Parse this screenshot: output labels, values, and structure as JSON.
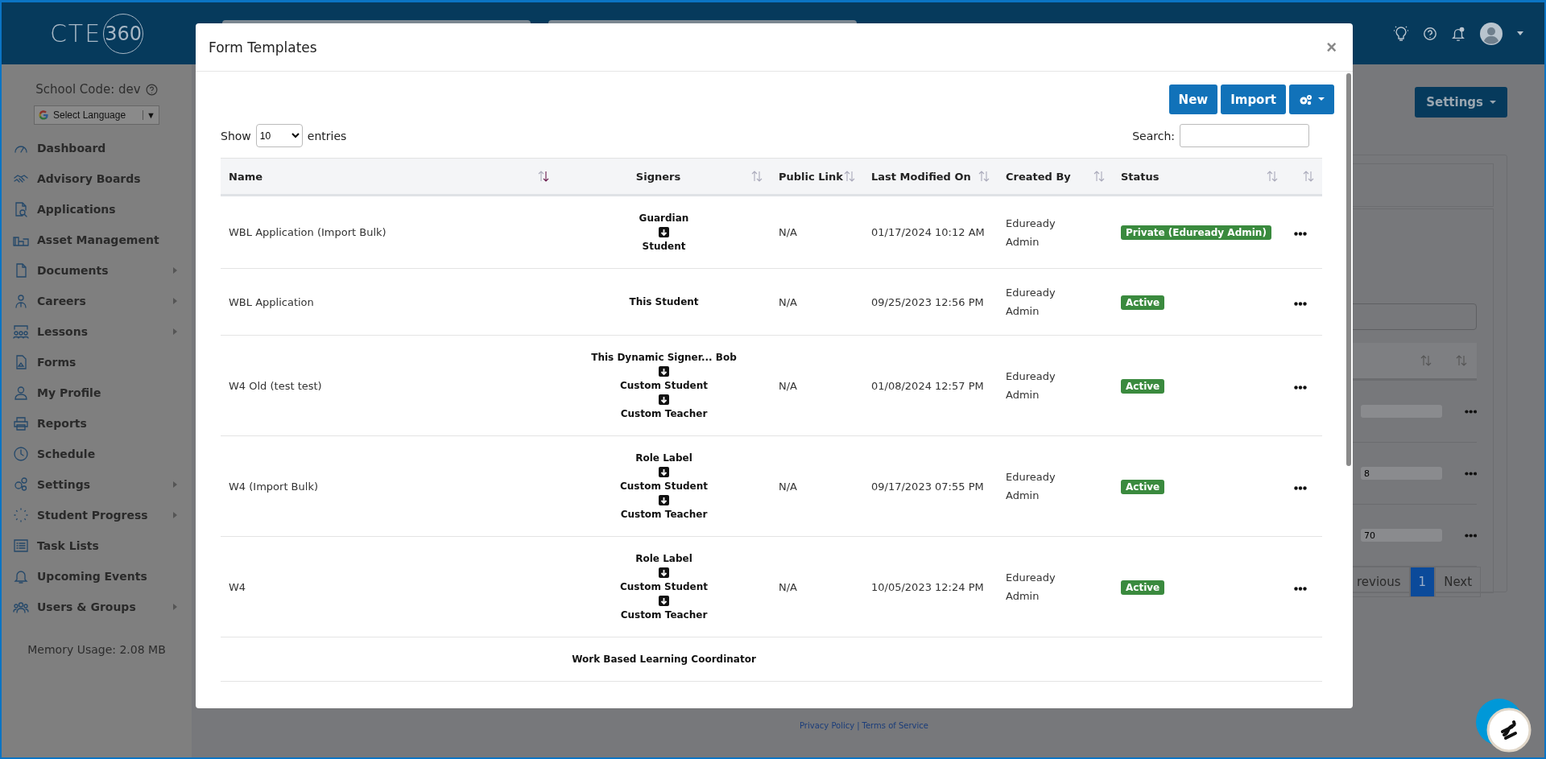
{
  "app": {
    "logo": "CTE",
    "logo_badge": "360"
  },
  "sidebar": {
    "school_code": "School Code: dev",
    "language": "Select Language",
    "language_arrow": "▼",
    "items": [
      {
        "label": "Dashboard",
        "has_submenu": false
      },
      {
        "label": "Advisory Boards",
        "has_submenu": false
      },
      {
        "label": "Applications",
        "has_submenu": false
      },
      {
        "label": "Asset Management",
        "has_submenu": false
      },
      {
        "label": "Documents",
        "has_submenu": true
      },
      {
        "label": "Careers",
        "has_submenu": true
      },
      {
        "label": "Lessons",
        "has_submenu": true
      },
      {
        "label": "Forms",
        "has_submenu": false
      },
      {
        "label": "My Profile",
        "has_submenu": false
      },
      {
        "label": "Reports",
        "has_submenu": false
      },
      {
        "label": "Schedule",
        "has_submenu": false
      },
      {
        "label": "Settings",
        "has_submenu": true
      },
      {
        "label": "Student Progress",
        "has_submenu": true
      },
      {
        "label": "Task Lists",
        "has_submenu": false
      },
      {
        "label": "Upcoming Events",
        "has_submenu": false
      },
      {
        "label": "Users & Groups",
        "has_submenu": true
      }
    ],
    "memory": "Memory Usage: 2.08 MB"
  },
  "background": {
    "settings_button": "Settings",
    "tags": [
      "8",
      "70"
    ],
    "pagination": [
      {
        "label": "revious",
        "selected": false
      },
      {
        "label": "1",
        "selected": true
      },
      {
        "label": "Next",
        "selected": false
      }
    ],
    "footer": {
      "links": [
        "Privacy Policy",
        "Terms of Service"
      ],
      "separator": "|"
    }
  },
  "modal": {
    "title": "Form Templates",
    "close": "×",
    "buttons": [
      "New",
      "Import"
    ],
    "show_label": "Show",
    "entries_value": "10",
    "entries_label": "entries",
    "search_label": "Search:",
    "columns": [
      {
        "label": "Name",
        "sorted": true
      },
      {
        "label": "Signers",
        "sorted": false
      },
      {
        "label": "Public Link",
        "sorted": false
      },
      {
        "label": "Last Modified On",
        "sorted": false
      },
      {
        "label": "Created By",
        "sorted": false
      },
      {
        "label": "Status",
        "sorted": false
      },
      {
        "sorted": false
      }
    ],
    "rows": [
      {
        "name": "WBL Application (Import Bulk)",
        "signers": [
          "Guardian",
          "Student"
        ],
        "public_link": "N/A",
        "modified": "01/17/2024 10:12 AM",
        "created_by": "Eduready Admin",
        "status": "Private (Eduready Admin)"
      },
      {
        "name": "WBL Application",
        "signers": [
          "This Student"
        ],
        "public_link": "N/A",
        "modified": "09/25/2023 12:56 PM",
        "created_by": "Eduready Admin",
        "status": "Active"
      },
      {
        "name": "W4 Old (test test)",
        "signers": [
          "This Dynamic Signer... Bob",
          "Custom Student",
          "Custom Teacher"
        ],
        "public_link": "N/A",
        "modified": "01/08/2024 12:57 PM",
        "created_by": "Eduready Admin",
        "status": "Active"
      },
      {
        "name": "W4 (Import Bulk)",
        "signers": [
          "Role Label",
          "Custom Student",
          "Custom Teacher"
        ],
        "public_link": "N/A",
        "modified": "09/17/2023 07:55 PM",
        "created_by": "Eduready Admin",
        "status": "Active"
      },
      {
        "name": "W4",
        "signers": [
          "Role Label",
          "Custom Student",
          "Custom Teacher"
        ],
        "public_link": "N/A",
        "modified": "10/05/2023 12:24 PM",
        "created_by": "Eduready Admin",
        "status": "Active"
      },
      {
        "signers": [
          "Work Based Learning Coordinator"
        ]
      }
    ]
  }
}
